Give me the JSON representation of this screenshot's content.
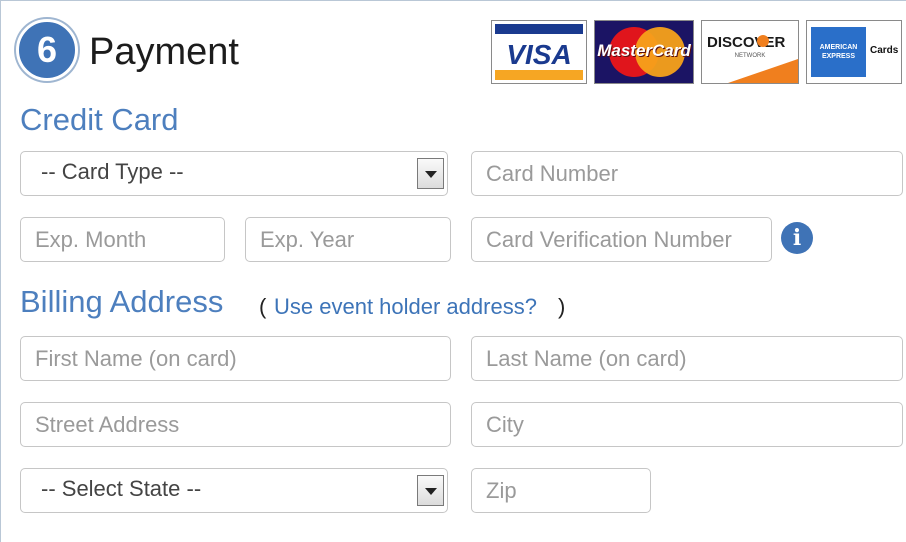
{
  "header": {
    "step_number": "6",
    "title": "Payment"
  },
  "card_logos": [
    {
      "name": "visa",
      "label": "VISA"
    },
    {
      "name": "mastercard",
      "label": "MasterCard"
    },
    {
      "name": "discover",
      "label": "DISCOVER",
      "sub": "NETWORK"
    },
    {
      "name": "american-express",
      "label": "AMERICAN EXPRESS",
      "sub": "Cards"
    }
  ],
  "credit_card": {
    "heading": "Credit Card",
    "card_type": {
      "selected": "-- Card Type --"
    },
    "card_number": {
      "placeholder": "Card Number"
    },
    "exp_month": {
      "placeholder": "Exp. Month"
    },
    "exp_year": {
      "placeholder": "Exp. Year"
    },
    "cvv": {
      "placeholder": "Card Verification Number"
    },
    "info_icon": "info-icon"
  },
  "billing": {
    "heading": "Billing Address",
    "paren_open": "(",
    "use_holder_link": "Use event holder address?",
    "paren_close": ")",
    "first_name": {
      "placeholder": "First Name (on card)"
    },
    "last_name": {
      "placeholder": "Last Name (on card)"
    },
    "street": {
      "placeholder": "Street Address"
    },
    "city": {
      "placeholder": "City"
    },
    "state": {
      "selected": "-- Select State --"
    },
    "zip": {
      "placeholder": "Zip"
    }
  },
  "colors": {
    "accent": "#3f73b6",
    "heading": "#4d7fbe",
    "link": "#3d74b8"
  }
}
